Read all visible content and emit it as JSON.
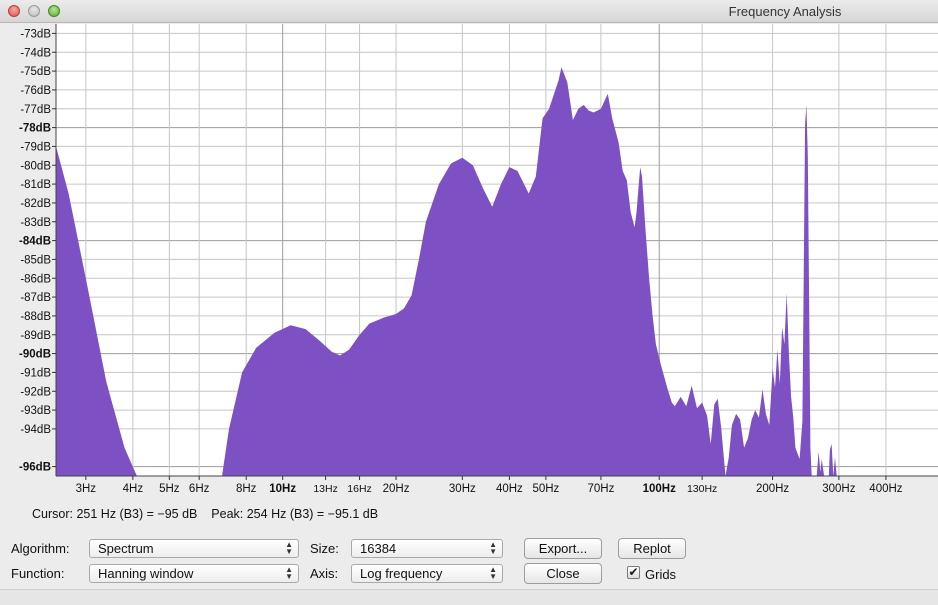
{
  "window": {
    "title": "Frequency Analysis"
  },
  "chart_data": {
    "type": "area",
    "xscale": "log",
    "xlim": [
      2.5,
      550
    ],
    "ylim": [
      -96.5,
      -72.5
    ],
    "grid": true,
    "fill_color": "#7d50c3",
    "y_ticks": [
      {
        "value": -73,
        "label": "-73dB"
      },
      {
        "value": -74,
        "label": "-74dB"
      },
      {
        "value": -75,
        "label": "-75dB"
      },
      {
        "value": -76,
        "label": "-76dB"
      },
      {
        "value": -77,
        "label": "-77dB"
      },
      {
        "value": -78,
        "label": "-78dB",
        "bold": true
      },
      {
        "value": -79,
        "label": "-79dB"
      },
      {
        "value": -80,
        "label": "-80dB"
      },
      {
        "value": -81,
        "label": "-81dB"
      },
      {
        "value": -82,
        "label": "-82dB"
      },
      {
        "value": -83,
        "label": "-83dB"
      },
      {
        "value": -84,
        "label": "-84dB",
        "bold": true
      },
      {
        "value": -85,
        "label": "-85dB"
      },
      {
        "value": -86,
        "label": "-86dB"
      },
      {
        "value": -87,
        "label": "-87dB"
      },
      {
        "value": -88,
        "label": "-88dB"
      },
      {
        "value": -89,
        "label": "-89dB"
      },
      {
        "value": -90,
        "label": "-90dB",
        "bold": true
      },
      {
        "value": -91,
        "label": "-91dB"
      },
      {
        "value": -92,
        "label": "-92dB"
      },
      {
        "value": -93,
        "label": "-93dB"
      },
      {
        "value": -94,
        "label": "-94dB"
      },
      {
        "value": -96,
        "label": "-96dB",
        "bold": true
      }
    ],
    "x_ticks": [
      {
        "value": 3,
        "label": "3Hz"
      },
      {
        "value": 4,
        "label": "4Hz"
      },
      {
        "value": 5,
        "label": "5Hz"
      },
      {
        "value": 6,
        "label": "6Hz"
      },
      {
        "value": 8,
        "label": "8Hz"
      },
      {
        "value": 10,
        "label": "10Hz",
        "bold": true
      },
      {
        "value": 13,
        "label": "13Hz",
        "small": true
      },
      {
        "value": 16,
        "label": "16Hz",
        "small": true
      },
      {
        "value": 20,
        "label": "20Hz"
      },
      {
        "value": 30,
        "label": "30Hz"
      },
      {
        "value": 40,
        "label": "40Hz"
      },
      {
        "value": 50,
        "label": "50Hz"
      },
      {
        "value": 70,
        "label": "70Hz"
      },
      {
        "value": 100,
        "label": "100Hz",
        "bold": true
      },
      {
        "value": 130,
        "label": "130Hz",
        "small": true
      },
      {
        "value": 200,
        "label": "200Hz"
      },
      {
        "value": 300,
        "label": "300Hz"
      },
      {
        "value": 400,
        "label": "400Hz"
      }
    ],
    "points": [
      [
        2.5,
        -79.0
      ],
      [
        2.7,
        -81.5
      ],
      [
        3.0,
        -86.0
      ],
      [
        3.4,
        -91.5
      ],
      [
        3.8,
        -95.0
      ],
      [
        4.1,
        -97.5
      ],
      [
        6.9,
        -97.5
      ],
      [
        7.2,
        -94.0
      ],
      [
        7.8,
        -91.0
      ],
      [
        8.5,
        -89.7
      ],
      [
        9.5,
        -88.9
      ],
      [
        10.5,
        -88.5
      ],
      [
        11.5,
        -88.7
      ],
      [
        12.5,
        -89.3
      ],
      [
        13.5,
        -89.9
      ],
      [
        14.2,
        -90.1
      ],
      [
        15.0,
        -89.8
      ],
      [
        16.0,
        -89.0
      ],
      [
        17.0,
        -88.4
      ],
      [
        18.5,
        -88.1
      ],
      [
        20.0,
        -87.9
      ],
      [
        21.0,
        -87.6
      ],
      [
        22.0,
        -86.9
      ],
      [
        23.0,
        -85.0
      ],
      [
        24.0,
        -83.0
      ],
      [
        26.0,
        -81.0
      ],
      [
        28.0,
        -79.9
      ],
      [
        30.0,
        -79.6
      ],
      [
        32.0,
        -80.0
      ],
      [
        34.0,
        -81.2
      ],
      [
        36.0,
        -82.2
      ],
      [
        38.0,
        -81.0
      ],
      [
        40.0,
        -80.1
      ],
      [
        42.0,
        -80.3
      ],
      [
        44.0,
        -81.1
      ],
      [
        45.0,
        -81.5
      ],
      [
        47.0,
        -80.6
      ],
      [
        49.0,
        -77.5
      ],
      [
        51.0,
        -77.0
      ],
      [
        54.0,
        -75.5
      ],
      [
        55.0,
        -74.8
      ],
      [
        57.0,
        -75.6
      ],
      [
        59.0,
        -77.6
      ],
      [
        61.0,
        -77.0
      ],
      [
        63.0,
        -76.8
      ],
      [
        65.0,
        -77.1
      ],
      [
        67.0,
        -77.2
      ],
      [
        70.0,
        -77.0
      ],
      [
        73.0,
        -76.2
      ],
      [
        75.0,
        -77.5
      ],
      [
        78.0,
        -78.8
      ],
      [
        80.0,
        -80.3
      ],
      [
        82.0,
        -80.8
      ],
      [
        84.0,
        -82.5
      ],
      [
        86.0,
        -83.3
      ],
      [
        87.0,
        -82.5
      ],
      [
        89.0,
        -80.1
      ],
      [
        90.0,
        -80.6
      ],
      [
        92.0,
        -83.5
      ],
      [
        94.0,
        -86.0
      ],
      [
        96.0,
        -88.0
      ],
      [
        98.0,
        -89.5
      ],
      [
        101.0,
        -90.6
      ],
      [
        105.0,
        -91.8
      ],
      [
        108.0,
        -92.6
      ],
      [
        110.0,
        -92.8
      ],
      [
        114.0,
        -92.3
      ],
      [
        118.0,
        -92.8
      ],
      [
        122.0,
        -91.7
      ],
      [
        126.0,
        -92.9
      ],
      [
        130.0,
        -92.6
      ],
      [
        134.0,
        -93.3
      ],
      [
        137.0,
        -94.8
      ],
      [
        140.0,
        -92.7
      ],
      [
        143.0,
        -92.4
      ],
      [
        146.0,
        -93.9
      ],
      [
        150.0,
        -96.5
      ],
      [
        153.0,
        -95.5
      ],
      [
        156.0,
        -93.8
      ],
      [
        160.0,
        -93.2
      ],
      [
        164.0,
        -93.5
      ],
      [
        168.0,
        -95.0
      ],
      [
        172.0,
        -94.5
      ],
      [
        176.0,
        -93.5
      ],
      [
        180.0,
        -93.0
      ],
      [
        184.0,
        -93.4
      ],
      [
        188.0,
        -91.9
      ],
      [
        192.0,
        -93.2
      ],
      [
        196.0,
        -93.8
      ],
      [
        200.0,
        -90.8
      ],
      [
        203.0,
        -91.8
      ],
      [
        206.0,
        -89.8
      ],
      [
        209.0,
        -91.6
      ],
      [
        212.0,
        -88.6
      ],
      [
        215.0,
        -89.5
      ],
      [
        218.0,
        -86.8
      ],
      [
        221.0,
        -90.0
      ],
      [
        224.0,
        -92.3
      ],
      [
        227.0,
        -93.4
      ],
      [
        230.0,
        -95.0
      ],
      [
        236.0,
        -95.6
      ],
      [
        240.0,
        -93.6
      ],
      [
        244.0,
        -77.8
      ],
      [
        246.0,
        -76.8
      ],
      [
        248.0,
        -79.5
      ],
      [
        250.0,
        -87.0
      ],
      [
        252.0,
        -95.0
      ],
      [
        254.0,
        -97.5
      ],
      [
        262.0,
        -97.5
      ],
      [
        265.0,
        -95.2
      ],
      [
        268.0,
        -96.3
      ],
      [
        270.0,
        -95.6
      ],
      [
        274.0,
        -96.7
      ],
      [
        276.0,
        -97.5
      ],
      [
        282.0,
        -97.5
      ],
      [
        284.0,
        -95.1
      ],
      [
        287.0,
        -94.8
      ],
      [
        290.0,
        -96.5
      ],
      [
        293.0,
        -95.5
      ],
      [
        296.0,
        -97.5
      ],
      [
        550.0,
        -97.5
      ]
    ]
  },
  "status": {
    "cursor_label": "Cursor:",
    "cursor_value": "251 Hz (B3) = −95 dB",
    "peak_label": "Peak:",
    "peak_value": "254 Hz (B3) = −95.1 dB"
  },
  "controls": {
    "algorithm_label": "Algorithm:",
    "algorithm_value": "Spectrum",
    "function_label": "Function:",
    "function_value": "Hanning window",
    "size_label": "Size:",
    "size_value": "16384",
    "axis_label": "Axis:",
    "axis_value": "Log frequency",
    "export_label": "Export...",
    "replot_label": "Replot",
    "close_label": "Close",
    "grids_label": "Grids",
    "grids_checked": true
  }
}
